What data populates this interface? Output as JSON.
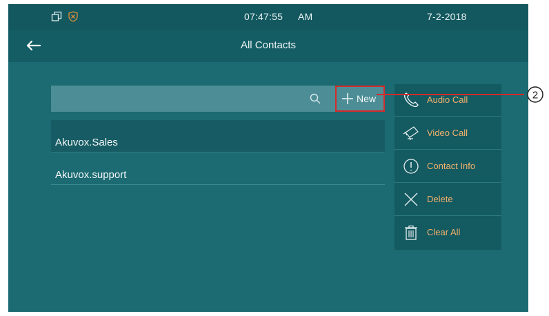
{
  "status_bar": {
    "time": "07:47:55",
    "ampm": "AM",
    "date": "7-2-2018",
    "icons": [
      "window-icon",
      "shield-x-icon"
    ]
  },
  "title_bar": {
    "title": "All Contacts",
    "back_icon": "back-arrow-icon"
  },
  "search": {
    "placeholder": "",
    "value": "",
    "icon": "search-icon"
  },
  "new_button": {
    "label": "New",
    "icon": "plus-icon"
  },
  "contacts": [
    {
      "name": "Akuvox.Sales"
    },
    {
      "name": "Akuvox.support"
    }
  ],
  "context_menu": {
    "items": [
      {
        "label": "Audio Call",
        "icon": "phone-icon"
      },
      {
        "label": "Video Call",
        "icon": "video-camera-icon"
      },
      {
        "label": "Contact Info",
        "icon": "info-icon"
      },
      {
        "label": "Delete",
        "icon": "delete-x-icon"
      },
      {
        "label": "Clear All",
        "icon": "trash-icon"
      }
    ]
  },
  "annotation": {
    "callout_label": "2"
  },
  "colors": {
    "screen_bg": "#1c6a72",
    "status_bar_bg": "#13585f",
    "menu_label": "#f3b26b",
    "highlight_border": "#d42a2a"
  }
}
